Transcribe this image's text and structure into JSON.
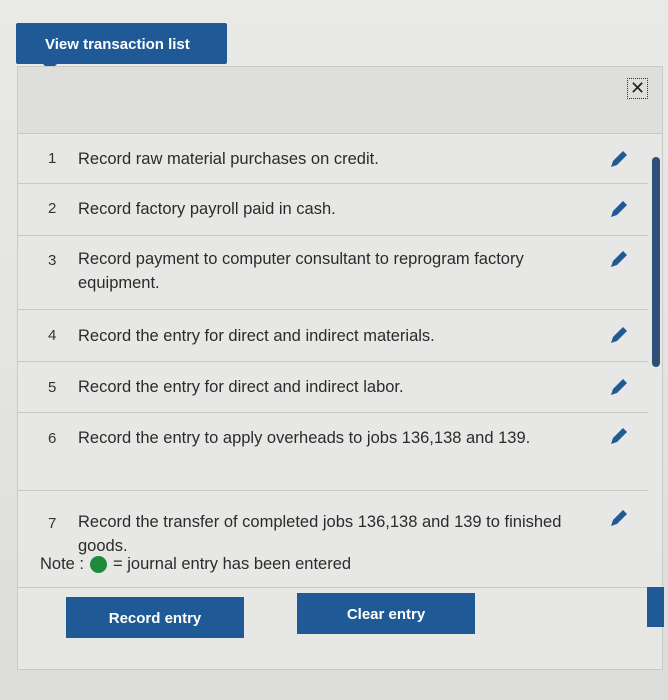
{
  "tab": {
    "label": "View transaction list"
  },
  "header": {
    "close_icon": "close-icon"
  },
  "transactions": [
    {
      "num": "1",
      "text": "Record raw material purchases on credit."
    },
    {
      "num": "2",
      "text": "Record factory payroll paid in cash."
    },
    {
      "num": "3",
      "text": "Record payment to computer consultant to reprogram factory equipment."
    },
    {
      "num": "4",
      "text": "Record the entry for direct and indirect materials."
    },
    {
      "num": "5",
      "text": "Record the entry for direct and indirect labor."
    },
    {
      "num": "6",
      "text": "Record the entry to apply overheads to jobs 136,138 and 139."
    },
    {
      "num": "7",
      "text": "Record the transfer of completed jobs 136,138 and 139 to finished goods."
    }
  ],
  "note": {
    "label": "Note :",
    "suffix": "= journal entry has been entered",
    "dot_color": "#1f8a3a"
  },
  "buttons": {
    "record": "Record entry",
    "clear": "Clear entry"
  },
  "colors": {
    "accent": "#1f5a96"
  }
}
